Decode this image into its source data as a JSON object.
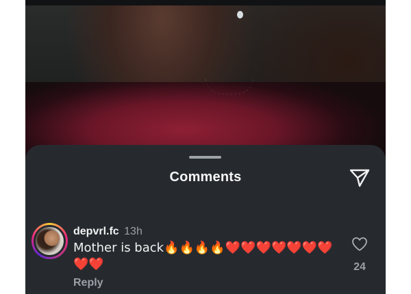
{
  "sheet": {
    "title": "Comments"
  },
  "comment": {
    "username": "depvrl.fc",
    "time": "13h",
    "text": "Mother is back🔥🔥🔥🔥❤️❤️❤️❤️❤️❤️❤️❤️❤️",
    "reply_label": "Reply",
    "like_count": "24"
  },
  "icons": {
    "share": "paper-plane-icon",
    "like": "heart-outline-icon"
  },
  "colors": {
    "sheet_background": "#262a2f",
    "text_primary": "#f2f2f2",
    "text_secondary": "#9aa0a6"
  }
}
